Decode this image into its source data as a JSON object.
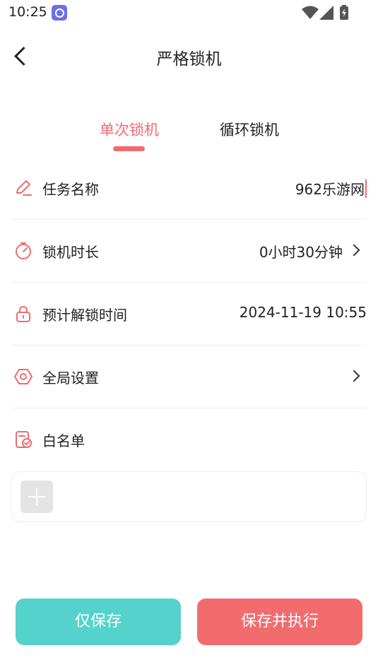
{
  "status_bar": {
    "time": "10:25"
  },
  "nav": {
    "title": "严格锁机"
  },
  "tabs": [
    {
      "label": "单次锁机",
      "active": true
    },
    {
      "label": "循环锁机",
      "active": false
    }
  ],
  "rows": {
    "task_name": {
      "label": "任务名称",
      "value": "962乐游网",
      "icon": "pencil-icon"
    },
    "duration": {
      "label": "锁机时长",
      "value": "0小时30分钟",
      "icon": "timer-icon"
    },
    "unlock_time": {
      "label": "预计解锁时间",
      "value": "2024-11-19 10:55",
      "icon": "lock-icon"
    },
    "global_settings": {
      "label": "全局设置",
      "icon": "hexagon-gear-icon"
    },
    "whitelist": {
      "label": "白名单",
      "icon": "checklist-icon"
    }
  },
  "buttons": {
    "save": "仅保存",
    "save_execute": "保存并执行"
  },
  "colors": {
    "accent": "#f06b6f",
    "teal": "#56d2cc",
    "exec": "#f26c6e"
  }
}
